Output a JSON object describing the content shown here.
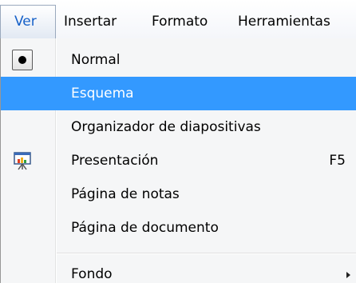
{
  "menubar": {
    "ver": "Ver",
    "insertar": "Insertar",
    "formato": "Formato",
    "herramientas": "Herramientas"
  },
  "menu": {
    "normal": "Normal",
    "esquema": "Esquema",
    "organizador": "Organizador de diapositivas",
    "presentacion": "Presentación",
    "presentacion_shortcut": "F5",
    "pagina_notas": "Página de notas",
    "pagina_documento": "Página de documento",
    "fondo": "Fondo"
  },
  "colors": {
    "highlight": "#3399ff",
    "active_menu_text": "#1560c8"
  },
  "icons": {
    "normal": "radio-selected-icon",
    "presentacion": "slideshow-projector-icon",
    "fondo": "submenu-arrow-icon"
  }
}
